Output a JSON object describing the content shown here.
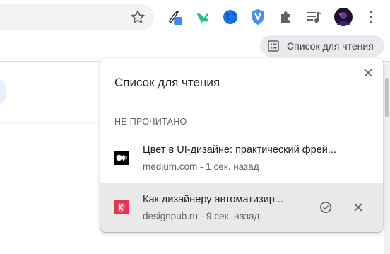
{
  "toolbar": {
    "icons": [
      "bookmark-star-icon",
      "color-picker-extension-icon",
      "bird-extension-icon",
      "globe-extension-icon",
      "shield-extension-icon",
      "extensions-puzzle-icon",
      "media-controls-icon",
      "profile-avatar",
      "menu-kebab-icon"
    ],
    "colors": {
      "picker_blue": "#4285f4",
      "bird_green": "#1fbf8f",
      "globe_blue": "#1a73e8",
      "shield_blue": "#4a90e2"
    }
  },
  "reading_list_button": {
    "label": "Список для чтения",
    "icon": "reading-list-icon"
  },
  "bubble": {
    "title": "Список для чтения",
    "close_icon": "close-icon",
    "section": "НЕ ПРОЧИТАНО",
    "items": [
      {
        "title": "Цвет в UI-дизайне: практический фрей...",
        "subtitle": "medium.com - 1 сек. назад",
        "favicon": "medium-favicon"
      },
      {
        "title": "Как дизайнеру автоматизир...",
        "subtitle": "designpub.ru - 9 сек. назад",
        "favicon": "designpub-favicon",
        "actions": [
          "mark-read-icon",
          "delete-icon"
        ]
      }
    ]
  }
}
